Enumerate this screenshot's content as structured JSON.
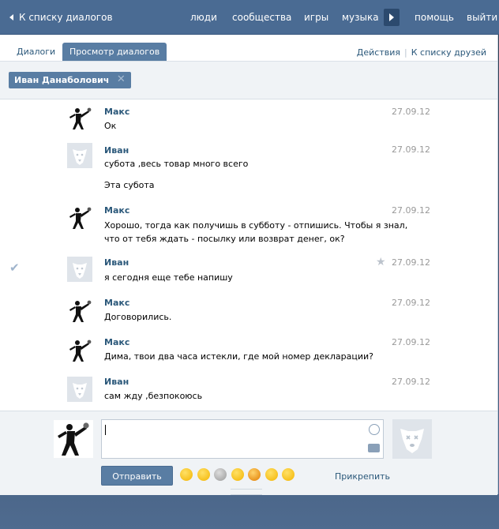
{
  "topbar": {
    "back_label": "К списку диалогов",
    "nav": [
      "люди",
      "сообщества",
      "игры",
      "музыка",
      "помощь",
      "выйти"
    ]
  },
  "tabs": {
    "dialogs": "Диалоги",
    "view": "Просмотр диалогов",
    "actions": "Действия",
    "friends": "К списку друзей"
  },
  "filter": {
    "chip_name": "Иван Данаболович"
  },
  "messages": [
    {
      "author": "Макс",
      "date": "27.09.12",
      "lines": [
        "Ок"
      ]
    },
    {
      "author": "Иван",
      "date": "27.09.12",
      "lines": [
        "субота ,весь товар много всего",
        "Эта субота"
      ]
    },
    {
      "author": "Макс",
      "date": "27.09.12",
      "lines": [
        "Хорошо, тогда как получишь в субботу - отпишись. Чтобы я знал,",
        "что от тебя ждать - посылку или возврат денег, ок?"
      ]
    },
    {
      "author": "Иван",
      "date": "27.09.12",
      "lines": [
        "я сегодня еще тебе напишу"
      ]
    },
    {
      "author": "Макс",
      "date": "27.09.12",
      "lines": [
        "Договорились."
      ]
    },
    {
      "author": "Макс",
      "date": "27.09.12",
      "lines": [
        "Дима, твои два часа истекли, где мой номер декларации?"
      ]
    },
    {
      "author": "Иван",
      "date": "27.09.12",
      "lines": [
        "сам жду ,безпокоюсь"
      ]
    }
  ],
  "composer": {
    "send_label": "Отправить",
    "attach_label": "Прикрепить",
    "emoji": [
      "grin-emoji",
      "laugh-emoji",
      "skull-emoji",
      "blush-emoji",
      "lollipop-emoji",
      "confused-emoji",
      "squint-emoji"
    ]
  },
  "colors": {
    "accent": "#597da3",
    "link": "#2b587a",
    "topbar": "#4a6b93"
  }
}
